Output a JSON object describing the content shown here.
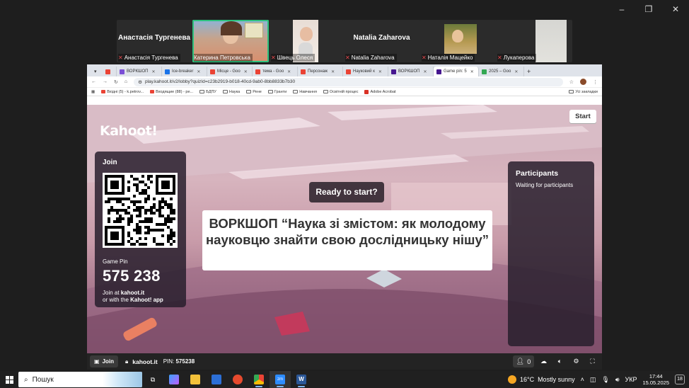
{
  "window_controls": {
    "minimize": "–",
    "restore": "❐",
    "close": "✕"
  },
  "gallery": {
    "participants": [
      {
        "big_name": "Анастасія Тургенева",
        "caption": "Анастасія Тургенева",
        "active": false,
        "video": false
      },
      {
        "big_name": "",
        "caption": "Катерина Петровська",
        "active": true,
        "video": true
      },
      {
        "big_name": "",
        "caption": "Швець Олеся",
        "active": false,
        "video": true
      },
      {
        "big_name": "Natalia Zaharova",
        "caption": "Natalia Zaharova",
        "active": false,
        "video": false
      },
      {
        "big_name": "",
        "caption": "Наталія Мацейко",
        "active": false,
        "video": true
      },
      {
        "big_name": "",
        "caption": "Лукаперова",
        "active": false,
        "video": true
      }
    ]
  },
  "browser": {
    "tabs": [
      {
        "label": "",
        "color": "#ea4335"
      },
      {
        "label": "ВОРКШОП",
        "color": "#7b4fd6"
      },
      {
        "label": "Ice-breaker",
        "color": "#1a73e8"
      },
      {
        "label": "Місце - Goo",
        "color": "#ea4335"
      },
      {
        "label": "тема - Goo",
        "color": "#ea4335"
      },
      {
        "label": "Персонаж",
        "color": "#ea4335"
      },
      {
        "label": "Науковий к",
        "color": "#ea4335"
      },
      {
        "label": "ВОРКШОП",
        "color": "#46178f"
      },
      {
        "label": "Game pin: 5",
        "color": "#46178f"
      },
      {
        "label": "2025 – Goo",
        "color": "#34a853"
      }
    ],
    "new_tab": "+",
    "url": "play.kahoot.it/v2/lobby?quizId=c23b2919-b018-40cd-9ab0-8bb8833b7b30",
    "bookmarks": [
      "Вхідні (5) - k.petrov...",
      "Входящие (88) - pe...",
      "БДПУ",
      "Наука",
      "Рене",
      "Гранти",
      "Навчання",
      "Освітній процес",
      "Adobe Acrobat"
    ],
    "all_bookmarks": "Усі закладки"
  },
  "kahoot": {
    "logo": "Kahoot!",
    "start_button": "Start",
    "join_title": "Join",
    "game_pin_label": "Game Pin",
    "game_pin": "575 238",
    "join_at_prefix": "Join at ",
    "join_at_site": "kahoot.it",
    "join_or": "or with the ",
    "join_app": "Kahoot! app",
    "ready": "Ready to start?",
    "quiz_title": "ВОРКШОП “Наука зі змістом: як молодому науковцю знайти свою дослідницьку нішу”",
    "participants_title": "Participants",
    "participants_status": "Waiting for participants",
    "bottom_join": "Join",
    "bottom_site": "kahoot.it",
    "bottom_pin_label": "PIN: ",
    "bottom_pin": "575238",
    "player_count": "0"
  },
  "taskbar": {
    "search_placeholder": "Пошук",
    "weather_temp": "16°C",
    "weather_desc": "Mostly sunny",
    "language": "УКР",
    "time": "17:44",
    "date": "15.05.2025",
    "notifications": "18"
  }
}
